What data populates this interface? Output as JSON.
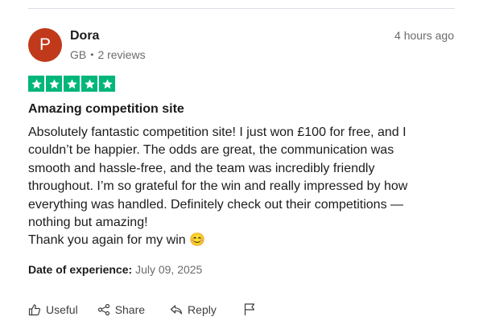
{
  "review": {
    "author": {
      "initial": "P",
      "name": "Dora",
      "country": "GB",
      "separator": "•",
      "reviews": "2 reviews",
      "avatar_color": "#c0391b"
    },
    "time_ago": "4 hours ago",
    "rating": 5,
    "star_color": "#00b67a",
    "title": "Amazing competition site",
    "body_lines": [
      "Absolutely fantastic competition site! I just won £100 for free, and I",
      "couldn’t be happier. The odds are great, the communication was",
      "smooth and hassle-free, and the team was incredibly friendly",
      "throughout. I’m so grateful for the win and really impressed by how",
      "everything was handled. Definitely check out their competitions —",
      "nothing but amazing!",
      "Thank you again for my win 😊"
    ],
    "date_of_experience": {
      "label": "Date of experience:",
      "value": "July 09, 2025"
    }
  },
  "actions": {
    "useful": "Useful",
    "share": "Share",
    "reply": "Reply",
    "flag_icon": "flag-icon"
  }
}
